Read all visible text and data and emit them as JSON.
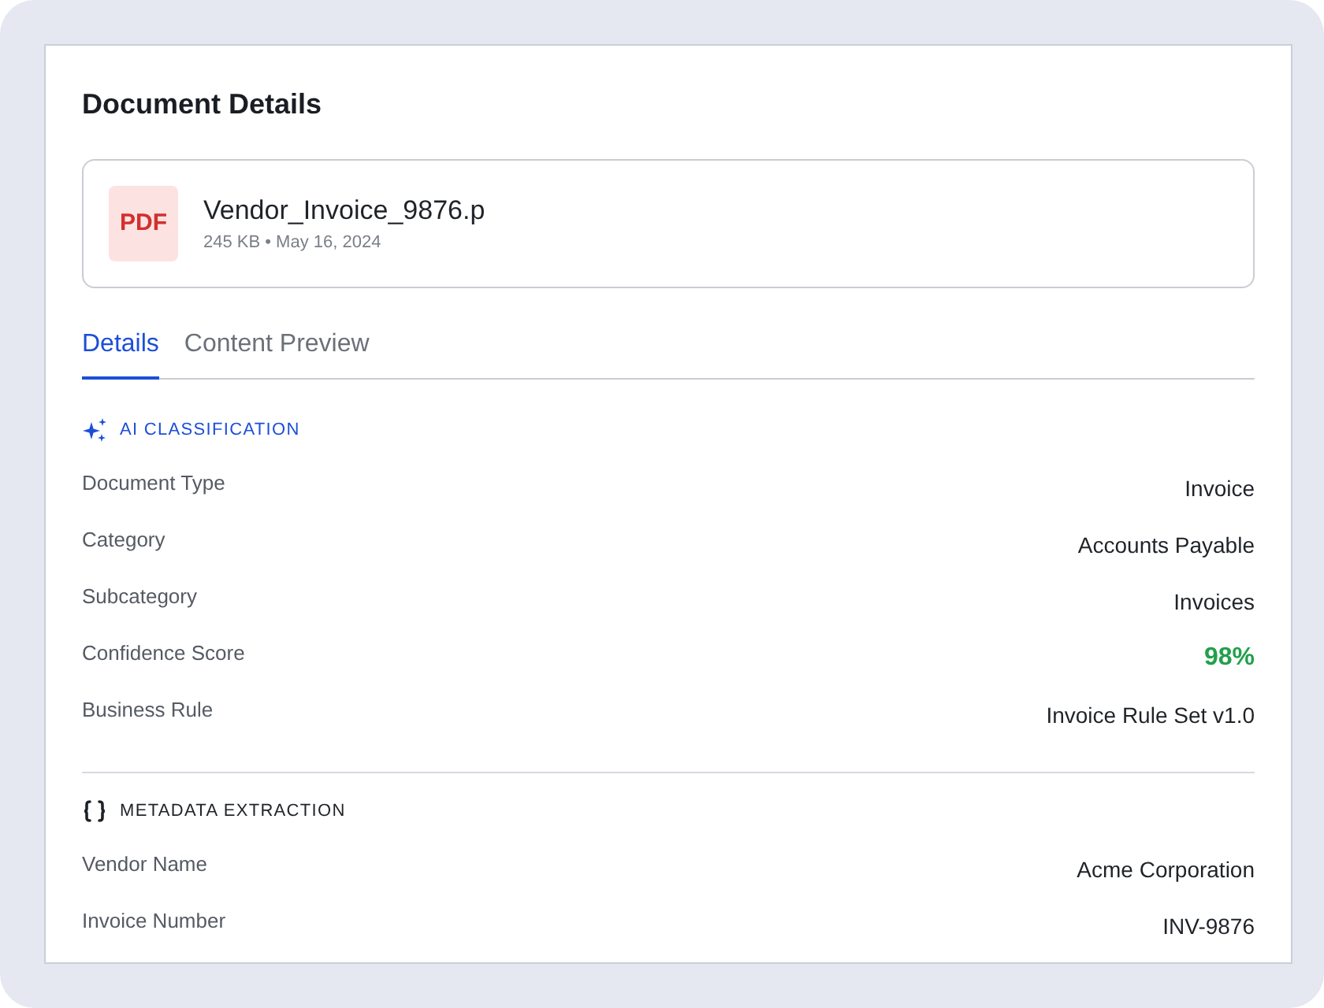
{
  "panel": {
    "title": "Document Details"
  },
  "file": {
    "badge": "PDF",
    "name": "Vendor_Invoice_9876.p",
    "meta": "245 KB • May 16, 2024"
  },
  "tabs": [
    {
      "label": "Details",
      "selected": true
    },
    {
      "label": "Content Preview",
      "selected": false
    }
  ],
  "sections": [
    {
      "kind": "ai",
      "title": "AI CLASSIFICATION",
      "rows": [
        {
          "label": "Document Type",
          "value": "Invoice",
          "kind": "text"
        },
        {
          "label": "Category",
          "value": "Accounts Payable",
          "kind": "text"
        },
        {
          "label": "Subcategory",
          "value": "Invoices",
          "kind": "text"
        },
        {
          "label": "Confidence Score",
          "value": "98%",
          "kind": "score"
        },
        {
          "label": "Business Rule",
          "value": "Invoice Rule Set v1.0",
          "kind": "text"
        }
      ]
    },
    {
      "kind": "extraction",
      "title": "METADATA EXTRACTION",
      "rows": [
        {
          "label": "Vendor Name",
          "value": "Acme Corporation",
          "kind": "text"
        },
        {
          "label": "Invoice Number",
          "value": "INV-9876",
          "kind": "text"
        }
      ]
    }
  ]
}
